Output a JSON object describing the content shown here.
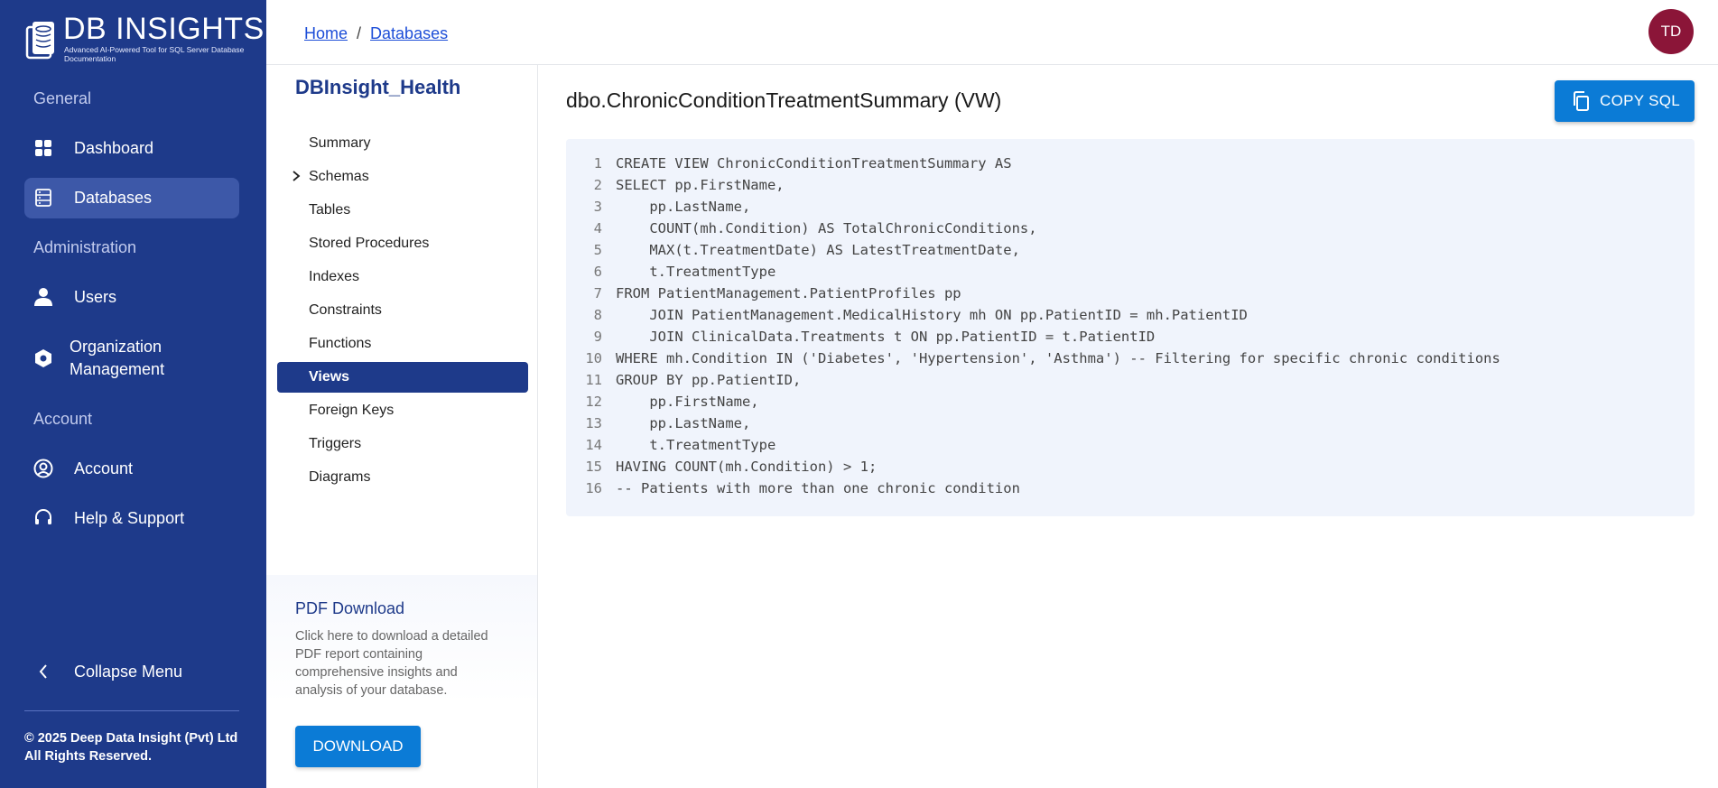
{
  "brand": {
    "name": "DB INSIGHTS",
    "tagline": "Advanced AI-Powered Tool for SQL Server Database Documentation"
  },
  "sidebar": {
    "sections": {
      "general": "General",
      "administration": "Administration",
      "account": "Account"
    },
    "items": {
      "dashboard": "Dashboard",
      "databases": "Databases",
      "users": "Users",
      "organization_line1": "Organization",
      "organization_line2": "Management",
      "account": "Account",
      "help": "Help & Support",
      "collapse": "Collapse Menu"
    },
    "copyright_line1": "© 2025 Deep Data Insight (Pvt) Ltd",
    "copyright_line2": "All Rights Reserved.",
    "active_item": "Databases"
  },
  "header": {
    "breadcrumb": [
      "Home",
      "Databases"
    ],
    "breadcrumb_separator": "/",
    "user_initials": "TD"
  },
  "subnav": {
    "database_name": "DBInsight_Health",
    "items": [
      "Summary",
      "Schemas",
      "Tables",
      "Stored Procedures",
      "Indexes",
      "Constraints",
      "Functions",
      "Views",
      "Foreign Keys",
      "Triggers",
      "Diagrams"
    ],
    "active_item": "Views"
  },
  "pdf": {
    "title": "PDF Download",
    "description": "Click here to download a detailed PDF report containing comprehensive insights and analysis of your database.",
    "button_label": "DOWNLOAD"
  },
  "main": {
    "title": "dbo.ChronicConditionTreatmentSummary (VW)",
    "copy_label": "COPY SQL",
    "code_lines": [
      "CREATE VIEW ChronicConditionTreatmentSummary AS",
      "SELECT pp.FirstName,",
      "    pp.LastName,",
      "    COUNT(mh.Condition) AS TotalChronicConditions,",
      "    MAX(t.TreatmentDate) AS LatestTreatmentDate,",
      "    t.TreatmentType",
      "FROM PatientManagement.PatientProfiles pp",
      "    JOIN PatientManagement.MedicalHistory mh ON pp.PatientID = mh.PatientID",
      "    JOIN ClinicalData.Treatments t ON pp.PatientID = t.PatientID",
      "WHERE mh.Condition IN ('Diabetes', 'Hypertension', 'Asthma') -- Filtering for specific chronic conditions",
      "GROUP BY pp.PatientID,",
      "    pp.FirstName,",
      "    pp.LastName,",
      "    t.TreatmentType",
      "HAVING COUNT(mh.Condition) > 1;",
      "-- Patients with more than one chronic condition"
    ]
  },
  "colors": {
    "sidebar_bg": "#1e3a8a",
    "accent_button": "#0b7bd6",
    "avatar_bg": "#8b1538",
    "code_bg": "#f0f4fc"
  }
}
